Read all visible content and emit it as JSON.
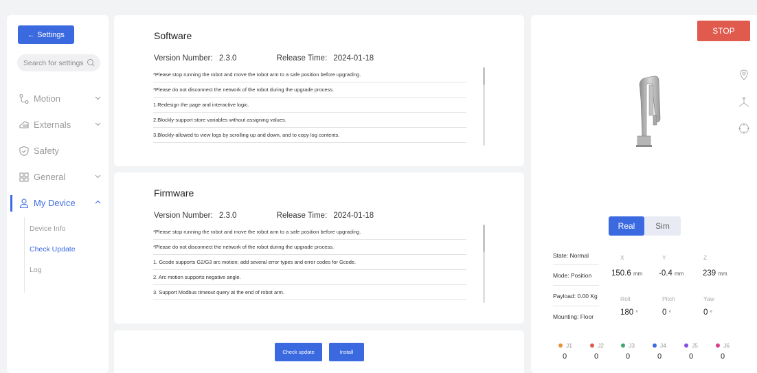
{
  "sidebar": {
    "back_label": "← Settings",
    "search_placeholder": "Search for settings",
    "items": [
      {
        "label": "Motion",
        "icon": "motion-icon",
        "expandable": true
      },
      {
        "label": "Externals",
        "icon": "externals-icon",
        "expandable": true
      },
      {
        "label": "Safety",
        "icon": "shield-icon",
        "expandable": false
      },
      {
        "label": "General",
        "icon": "grid-icon",
        "expandable": true
      },
      {
        "label": "My Device",
        "icon": "user-icon",
        "expandable": true
      }
    ],
    "submenu": [
      "Device Info",
      "Check Update",
      "Log"
    ],
    "active_submenu": "Check Update"
  },
  "software": {
    "title": "Software",
    "version_label": "Version Number:",
    "version": "2.3.0",
    "release_label": "Release Time:",
    "release": "2024-01-18",
    "notes": [
      "*Please stop running the robot and move the robot arm to a safe position before upgrading.",
      "*Please do not disconnect the network of the robot during the upgrade process.",
      "1.Redesign the page and interactive logic.",
      "2.Blockly-support store variables without assigning values.",
      "3.Blockly-allowed to view logs by scrolling up and down, and to copy log contents."
    ]
  },
  "firmware": {
    "title": "Firmware",
    "version_label": "Version Number:",
    "version": "2.3.0",
    "release_label": "Release Time:",
    "release": "2024-01-18",
    "notes": [
      "*Please stop running the robot and move the robot arm to a safe position before upgrading.",
      "*Please do not disconnect the network of the robot during the upgrade process.",
      "1. Gcode supports G2/G3 arc motion; add several error types and error codes for Gcode.",
      "2. Arc motion supports negative angle.",
      "3. Support Modbus timeout query at the end of robot arm."
    ]
  },
  "actions": {
    "check_update": "Check update",
    "install": "Install"
  },
  "robot": {
    "stop_label": "STOP",
    "mode_real": "Real",
    "mode_sim": "Sim",
    "state": "State: Normal",
    "mode": "Mode: Position",
    "payload": "Payload: 0.00 Kg",
    "mounting": "Mounting: Floor",
    "axes": [
      {
        "label": "X",
        "value": "150.6",
        "unit": "mm"
      },
      {
        "label": "Y",
        "value": "-0.4",
        "unit": "mm"
      },
      {
        "label": "Z",
        "value": "239",
        "unit": "mm"
      },
      {
        "label": "Roll",
        "value": "180",
        "unit": "°"
      },
      {
        "label": "Pitch",
        "value": "0",
        "unit": "°"
      },
      {
        "label": "Yaw",
        "value": "0",
        "unit": "°"
      }
    ],
    "joints": [
      {
        "label": "J1",
        "value": "0",
        "color": "#e8923a"
      },
      {
        "label": "J2",
        "value": "0",
        "color": "#e05a4e"
      },
      {
        "label": "J3",
        "value": "0",
        "color": "#3ca86a"
      },
      {
        "label": "J4",
        "value": "0",
        "color": "#3b6ae0"
      },
      {
        "label": "J5",
        "value": "0",
        "color": "#8a4fe0"
      },
      {
        "label": "J6",
        "value": "0",
        "color": "#d6408a"
      }
    ],
    "colors": {
      "accent": "#3b6ae0",
      "stop": "#e05a4e"
    }
  }
}
